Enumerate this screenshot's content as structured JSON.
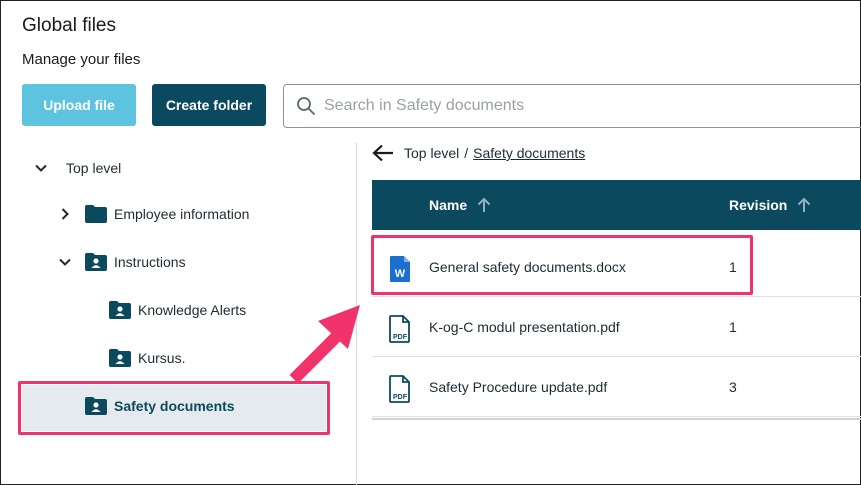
{
  "header": {
    "title": "Global files",
    "subtitle": "Manage your files"
  },
  "toolbar": {
    "upload_label": "Upload file",
    "create_folder_label": "Create folder"
  },
  "search": {
    "placeholder": "Search in Safety documents",
    "value": ""
  },
  "tree": {
    "root": {
      "label": "Top level",
      "expanded": true
    },
    "items": [
      {
        "label": "Employee information",
        "expanded": false
      },
      {
        "label": "Instructions",
        "expanded": true
      },
      {
        "label": "Knowledge Alerts"
      },
      {
        "label": "Kursus."
      },
      {
        "label": "Safety documents",
        "selected": true
      }
    ]
  },
  "breadcrumb": {
    "root": "Top level",
    "separator": "/",
    "current": "Safety documents"
  },
  "table": {
    "columns": [
      {
        "label": "Name"
      },
      {
        "label": "Revision"
      }
    ],
    "rows": [
      {
        "name": "General safety documents.docx",
        "revision": "1",
        "icon": "word-doc-icon"
      },
      {
        "name": "K-og-C modul presentation.pdf",
        "revision": "1",
        "icon": "pdf-icon"
      },
      {
        "name": "Safety Procedure update.pdf",
        "revision": "3",
        "icon": "pdf-icon"
      }
    ]
  },
  "colors": {
    "primary_dark": "#0b4a5e",
    "primary_light": "#5ec3de",
    "highlight": "#f0336b",
    "word_blue": "#1a6fd1"
  }
}
